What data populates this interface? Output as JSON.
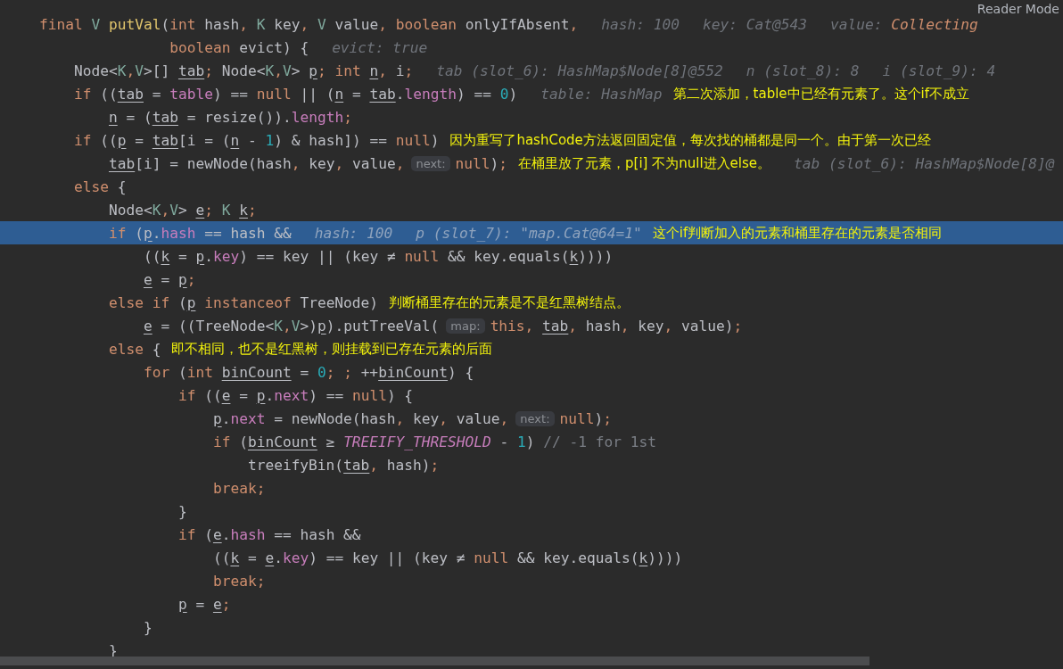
{
  "reader_mode": "Reader Mode",
  "lines": [
    {
      "highlighted": false,
      "segments": [
        {
          "kind": "code",
          "tokens": [
            {
              "kind": "kw",
              "text": "final "
            },
            {
              "kind": "generic",
              "text": "V "
            },
            {
              "kind": "method",
              "text": "putVal"
            },
            {
              "kind": "plain",
              "text": "("
            },
            {
              "kind": "kw",
              "text": "int "
            },
            {
              "kind": "plain",
              "text": "hash"
            },
            {
              "kind": "kw",
              "text": ", "
            },
            {
              "kind": "generic",
              "text": "K "
            },
            {
              "kind": "plain",
              "text": "key"
            },
            {
              "kind": "kw",
              "text": ", "
            },
            {
              "kind": "generic",
              "text": "V "
            },
            {
              "kind": "plain",
              "text": "value"
            },
            {
              "kind": "kw",
              "text": ", boolean "
            },
            {
              "kind": "plain",
              "text": "onlyIfAbsent"
            },
            {
              "kind": "kw",
              "text": ","
            }
          ]
        },
        {
          "kind": "hint",
          "tokens": [
            {
              "kind": "hint",
              "text": "hash: 100"
            }
          ]
        },
        {
          "kind": "hint",
          "tokens": [
            {
              "kind": "hint",
              "text": "key: Cat@543"
            }
          ]
        },
        {
          "kind": "hint",
          "tokens": [
            {
              "kind": "hint",
              "text": "value: "
            },
            {
              "kind": "hintvalue",
              "text": "Collecting"
            }
          ]
        }
      ]
    },
    {
      "highlighted": false,
      "segments": [
        {
          "kind": "code",
          "tokens": [
            {
              "kind": "kw",
              "text": "               boolean "
            },
            {
              "kind": "plain",
              "text": "evict) {"
            }
          ]
        },
        {
          "kind": "hint",
          "tokens": [
            {
              "kind": "hint",
              "text": "evict: true"
            }
          ]
        }
      ]
    },
    {
      "highlighted": false,
      "segments": [
        {
          "kind": "code",
          "tokens": [
            {
              "kind": "plain",
              "text": "    Node<"
            },
            {
              "kind": "generic",
              "text": "K"
            },
            {
              "kind": "kw",
              "text": ","
            },
            {
              "kind": "generic",
              "text": "V"
            },
            {
              "kind": "plain",
              "text": ">[] "
            },
            {
              "kind": "local",
              "text": "tab"
            },
            {
              "kind": "kw",
              "text": "; "
            },
            {
              "kind": "plain",
              "text": "Node<"
            },
            {
              "kind": "generic",
              "text": "K"
            },
            {
              "kind": "kw",
              "text": ","
            },
            {
              "kind": "generic",
              "text": "V"
            },
            {
              "kind": "plain",
              "text": "> "
            },
            {
              "kind": "local",
              "text": "p"
            },
            {
              "kind": "kw",
              "text": "; int "
            },
            {
              "kind": "local",
              "text": "n"
            },
            {
              "kind": "kw",
              "text": ", "
            },
            {
              "kind": "plain",
              "text": "i"
            },
            {
              "kind": "kw",
              "text": ";"
            }
          ]
        },
        {
          "kind": "hint",
          "tokens": [
            {
              "kind": "hint",
              "text": "tab (slot_6): HashMap$Node[8]@552"
            }
          ]
        },
        {
          "kind": "hint",
          "tokens": [
            {
              "kind": "hint",
              "text": "n (slot_8): 8"
            }
          ]
        },
        {
          "kind": "hint",
          "tokens": [
            {
              "kind": "hint",
              "text": "i (slot_9): 4"
            }
          ]
        }
      ]
    },
    {
      "highlighted": false,
      "segments": [
        {
          "kind": "code",
          "tokens": [
            {
              "kind": "kw",
              "text": "    if "
            },
            {
              "kind": "plain",
              "text": "(("
            },
            {
              "kind": "local",
              "text": "tab"
            },
            {
              "kind": "plain",
              "text": " = "
            },
            {
              "kind": "field",
              "text": "table"
            },
            {
              "kind": "plain",
              "text": ") == "
            },
            {
              "kind": "kw",
              "text": "null "
            },
            {
              "kind": "plain",
              "text": "|| ("
            },
            {
              "kind": "local",
              "text": "n"
            },
            {
              "kind": "plain",
              "text": " = "
            },
            {
              "kind": "local",
              "text": "tab"
            },
            {
              "kind": "plain",
              "text": "."
            },
            {
              "kind": "field",
              "text": "length"
            },
            {
              "kind": "plain",
              "text": ") == "
            },
            {
              "kind": "num",
              "text": "0"
            },
            {
              "kind": "plain",
              "text": ")"
            }
          ]
        },
        {
          "kind": "hint",
          "tokens": [
            {
              "kind": "hint",
              "text": "table: HashMap"
            }
          ]
        },
        {
          "kind": "note",
          "text": "第二次添加，table中已经有元素了。这个if不成立"
        }
      ]
    },
    {
      "highlighted": false,
      "segments": [
        {
          "kind": "code",
          "tokens": [
            {
              "kind": "local",
              "text": "        n"
            },
            {
              "kind": "plain",
              "text": " = ("
            },
            {
              "kind": "local",
              "text": "tab"
            },
            {
              "kind": "plain",
              "text": " = resize())."
            },
            {
              "kind": "field",
              "text": "length"
            },
            {
              "kind": "kw",
              "text": ";"
            }
          ]
        }
      ]
    },
    {
      "highlighted": false,
      "segments": [
        {
          "kind": "code",
          "tokens": [
            {
              "kind": "kw",
              "text": "    if "
            },
            {
              "kind": "plain",
              "text": "(("
            },
            {
              "kind": "local",
              "text": "p"
            },
            {
              "kind": "plain",
              "text": " = "
            },
            {
              "kind": "local",
              "text": "tab"
            },
            {
              "kind": "plain",
              "text": "[i = ("
            },
            {
              "kind": "local",
              "text": "n"
            },
            {
              "kind": "plain",
              "text": " - "
            },
            {
              "kind": "num",
              "text": "1"
            },
            {
              "kind": "plain",
              "text": ") & hash]) == "
            },
            {
              "kind": "kw",
              "text": "null"
            },
            {
              "kind": "plain",
              "text": ")"
            }
          ]
        },
        {
          "kind": "note",
          "text": "因为重写了hashCode方法返回固定值，每次找的桶都是同一个。由于第一次已经"
        }
      ]
    },
    {
      "highlighted": false,
      "segments": [
        {
          "kind": "code",
          "tokens": [
            {
              "kind": "local",
              "text": "        tab"
            },
            {
              "kind": "plain",
              "text": "[i] = newNode(hash"
            },
            {
              "kind": "kw",
              "text": ", "
            },
            {
              "kind": "plain",
              "text": "key"
            },
            {
              "kind": "kw",
              "text": ", "
            },
            {
              "kind": "plain",
              "text": "value"
            },
            {
              "kind": "kw",
              "text": ","
            }
          ]
        },
        {
          "kind": "param",
          "text": "next:"
        },
        {
          "kind": "code",
          "tokens": [
            {
              "kind": "kw",
              "text": "null"
            },
            {
              "kind": "plain",
              "text": ")"
            },
            {
              "kind": "kw",
              "text": ";"
            }
          ]
        },
        {
          "kind": "note",
          "text": "在桶里放了元素，p[i] 不为null进入else。"
        },
        {
          "kind": "hint",
          "tokens": [
            {
              "kind": "hint",
              "text": "tab (slot_6): HashMap$Node[8]@"
            }
          ]
        }
      ]
    },
    {
      "highlighted": false,
      "segments": [
        {
          "kind": "code",
          "tokens": [
            {
              "kind": "kw",
              "text": "    else "
            },
            {
              "kind": "plain",
              "text": "{"
            }
          ]
        }
      ]
    },
    {
      "highlighted": false,
      "segments": [
        {
          "kind": "code",
          "tokens": [
            {
              "kind": "plain",
              "text": "        Node<"
            },
            {
              "kind": "generic",
              "text": "K"
            },
            {
              "kind": "kw",
              "text": ","
            },
            {
              "kind": "generic",
              "text": "V"
            },
            {
              "kind": "plain",
              "text": "> "
            },
            {
              "kind": "local",
              "text": "e"
            },
            {
              "kind": "kw",
              "text": "; "
            },
            {
              "kind": "generic",
              "text": "K "
            },
            {
              "kind": "local",
              "text": "k"
            },
            {
              "kind": "kw",
              "text": ";"
            }
          ]
        }
      ]
    },
    {
      "highlighted": true,
      "segments": [
        {
          "kind": "code",
          "tokens": [
            {
              "kind": "kw",
              "text": "        if "
            },
            {
              "kind": "plain",
              "text": "("
            },
            {
              "kind": "local",
              "text": "p"
            },
            {
              "kind": "plain",
              "text": "."
            },
            {
              "kind": "field",
              "text": "hash"
            },
            {
              "kind": "plain",
              "text": " == hash &&"
            }
          ]
        },
        {
          "kind": "hint",
          "tokens": [
            {
              "kind": "hint",
              "text": "hash: 100"
            }
          ]
        },
        {
          "kind": "hint",
          "tokens": [
            {
              "kind": "hint",
              "text": "p (slot_7): \"map.Cat@64=1\""
            }
          ]
        },
        {
          "kind": "note",
          "text": "这个if判断加入的元素和桶里存在的元素是否相同"
        }
      ]
    },
    {
      "highlighted": false,
      "segments": [
        {
          "kind": "code",
          "tokens": [
            {
              "kind": "plain",
              "text": "            (("
            },
            {
              "kind": "local",
              "text": "k"
            },
            {
              "kind": "plain",
              "text": " = "
            },
            {
              "kind": "local",
              "text": "p"
            },
            {
              "kind": "plain",
              "text": "."
            },
            {
              "kind": "field",
              "text": "key"
            },
            {
              "kind": "plain",
              "text": ") == key || (key ≠ "
            },
            {
              "kind": "kw",
              "text": "null "
            },
            {
              "kind": "plain",
              "text": "&& key.equals("
            },
            {
              "kind": "local",
              "text": "k"
            },
            {
              "kind": "plain",
              "text": "))))"
            }
          ]
        }
      ]
    },
    {
      "highlighted": false,
      "segments": [
        {
          "kind": "code",
          "tokens": [
            {
              "kind": "local",
              "text": "            e"
            },
            {
              "kind": "plain",
              "text": " = "
            },
            {
              "kind": "local",
              "text": "p"
            },
            {
              "kind": "kw",
              "text": ";"
            }
          ]
        }
      ]
    },
    {
      "highlighted": false,
      "segments": [
        {
          "kind": "code",
          "tokens": [
            {
              "kind": "kw",
              "text": "        else if "
            },
            {
              "kind": "plain",
              "text": "("
            },
            {
              "kind": "local",
              "text": "p"
            },
            {
              "kind": "kw",
              "text": " instanceof "
            },
            {
              "kind": "plain",
              "text": "TreeNode)"
            }
          ]
        },
        {
          "kind": "note",
          "text": "判断桶里存在的元素是不是红黑树结点。"
        }
      ]
    },
    {
      "highlighted": false,
      "segments": [
        {
          "kind": "code",
          "tokens": [
            {
              "kind": "local",
              "text": "            e"
            },
            {
              "kind": "plain",
              "text": " = ((TreeNode<"
            },
            {
              "kind": "generic",
              "text": "K"
            },
            {
              "kind": "kw",
              "text": ","
            },
            {
              "kind": "generic",
              "text": "V"
            },
            {
              "kind": "plain",
              "text": ">)"
            },
            {
              "kind": "local",
              "text": "p"
            },
            {
              "kind": "plain",
              "text": ").putTreeVal("
            }
          ]
        },
        {
          "kind": "param",
          "text": "map:"
        },
        {
          "kind": "code",
          "tokens": [
            {
              "kind": "kw",
              "text": "this, "
            },
            {
              "kind": "local",
              "text": "tab"
            },
            {
              "kind": "kw",
              "text": ", "
            },
            {
              "kind": "plain",
              "text": "hash"
            },
            {
              "kind": "kw",
              "text": ", "
            },
            {
              "kind": "plain",
              "text": "key"
            },
            {
              "kind": "kw",
              "text": ", "
            },
            {
              "kind": "plain",
              "text": "value)"
            },
            {
              "kind": "kw",
              "text": ";"
            }
          ]
        }
      ]
    },
    {
      "highlighted": false,
      "segments": [
        {
          "kind": "code",
          "tokens": [
            {
              "kind": "kw",
              "text": "        else "
            },
            {
              "kind": "plain",
              "text": "{"
            }
          ]
        },
        {
          "kind": "note",
          "text": "即不相同，也不是红黑树，则挂载到已存在元素的后面"
        }
      ]
    },
    {
      "highlighted": false,
      "segments": [
        {
          "kind": "code",
          "tokens": [
            {
              "kind": "kw",
              "text": "            for "
            },
            {
              "kind": "plain",
              "text": "("
            },
            {
              "kind": "kw",
              "text": "int "
            },
            {
              "kind": "local",
              "text": "binCount"
            },
            {
              "kind": "plain",
              "text": " = "
            },
            {
              "kind": "num",
              "text": "0"
            },
            {
              "kind": "kw",
              "text": "; ; "
            },
            {
              "kind": "plain",
              "text": "++"
            },
            {
              "kind": "local",
              "text": "binCount"
            },
            {
              "kind": "plain",
              "text": ") {"
            }
          ]
        }
      ]
    },
    {
      "highlighted": false,
      "segments": [
        {
          "kind": "code",
          "tokens": [
            {
              "kind": "kw",
              "text": "                if "
            },
            {
              "kind": "plain",
              "text": "(("
            },
            {
              "kind": "local",
              "text": "e"
            },
            {
              "kind": "plain",
              "text": " = "
            },
            {
              "kind": "local",
              "text": "p"
            },
            {
              "kind": "plain",
              "text": "."
            },
            {
              "kind": "field",
              "text": "next"
            },
            {
              "kind": "plain",
              "text": ") == "
            },
            {
              "kind": "kw",
              "text": "null"
            },
            {
              "kind": "plain",
              "text": ") {"
            }
          ]
        }
      ]
    },
    {
      "highlighted": false,
      "segments": [
        {
          "kind": "code",
          "tokens": [
            {
              "kind": "local",
              "text": "                    p"
            },
            {
              "kind": "plain",
              "text": "."
            },
            {
              "kind": "field",
              "text": "next"
            },
            {
              "kind": "plain",
              "text": " = newNode(hash"
            },
            {
              "kind": "kw",
              "text": ", "
            },
            {
              "kind": "plain",
              "text": "key"
            },
            {
              "kind": "kw",
              "text": ", "
            },
            {
              "kind": "plain",
              "text": "value"
            },
            {
              "kind": "kw",
              "text": ","
            }
          ]
        },
        {
          "kind": "param",
          "text": "next:"
        },
        {
          "kind": "code",
          "tokens": [
            {
              "kind": "kw",
              "text": "null"
            },
            {
              "kind": "plain",
              "text": ")"
            },
            {
              "kind": "kw",
              "text": ";"
            }
          ]
        }
      ]
    },
    {
      "highlighted": false,
      "segments": [
        {
          "kind": "code",
          "tokens": [
            {
              "kind": "kw",
              "text": "                    if "
            },
            {
              "kind": "plain",
              "text": "("
            },
            {
              "kind": "local",
              "text": "binCount"
            },
            {
              "kind": "plain",
              "text": " ≥ "
            },
            {
              "kind": "const",
              "text": "TREEIFY_THRESHOLD"
            },
            {
              "kind": "plain",
              "text": " - "
            },
            {
              "kind": "num",
              "text": "1"
            },
            {
              "kind": "plain",
              "text": ") "
            },
            {
              "kind": "comment",
              "text": "// -1 for 1st"
            }
          ]
        }
      ]
    },
    {
      "highlighted": false,
      "segments": [
        {
          "kind": "code",
          "tokens": [
            {
              "kind": "plain",
              "text": "                        treeifyBin("
            },
            {
              "kind": "local",
              "text": "tab"
            },
            {
              "kind": "kw",
              "text": ", "
            },
            {
              "kind": "plain",
              "text": "hash)"
            },
            {
              "kind": "kw",
              "text": ";"
            }
          ]
        }
      ]
    },
    {
      "highlighted": false,
      "segments": [
        {
          "kind": "code",
          "tokens": [
            {
              "kind": "kw",
              "text": "                    break;"
            }
          ]
        }
      ]
    },
    {
      "highlighted": false,
      "segments": [
        {
          "kind": "code",
          "tokens": [
            {
              "kind": "plain",
              "text": "                }"
            }
          ]
        }
      ]
    },
    {
      "highlighted": false,
      "segments": [
        {
          "kind": "code",
          "tokens": [
            {
              "kind": "kw",
              "text": "                if "
            },
            {
              "kind": "plain",
              "text": "("
            },
            {
              "kind": "local",
              "text": "e"
            },
            {
              "kind": "plain",
              "text": "."
            },
            {
              "kind": "field",
              "text": "hash"
            },
            {
              "kind": "plain",
              "text": " == hash &&"
            }
          ]
        }
      ]
    },
    {
      "highlighted": false,
      "segments": [
        {
          "kind": "code",
          "tokens": [
            {
              "kind": "plain",
              "text": "                    (("
            },
            {
              "kind": "local",
              "text": "k"
            },
            {
              "kind": "plain",
              "text": " = "
            },
            {
              "kind": "local",
              "text": "e"
            },
            {
              "kind": "plain",
              "text": "."
            },
            {
              "kind": "field",
              "text": "key"
            },
            {
              "kind": "plain",
              "text": ") == key || (key ≠ "
            },
            {
              "kind": "kw",
              "text": "null "
            },
            {
              "kind": "plain",
              "text": "&& key.equals("
            },
            {
              "kind": "local",
              "text": "k"
            },
            {
              "kind": "plain",
              "text": "))))"
            }
          ]
        }
      ]
    },
    {
      "highlighted": false,
      "segments": [
        {
          "kind": "code",
          "tokens": [
            {
              "kind": "kw",
              "text": "                    break;"
            }
          ]
        }
      ]
    },
    {
      "highlighted": false,
      "segments": [
        {
          "kind": "code",
          "tokens": [
            {
              "kind": "local",
              "text": "                p"
            },
            {
              "kind": "plain",
              "text": " = "
            },
            {
              "kind": "local",
              "text": "e"
            },
            {
              "kind": "kw",
              "text": ";"
            }
          ]
        }
      ]
    },
    {
      "highlighted": false,
      "segments": [
        {
          "kind": "code",
          "tokens": [
            {
              "kind": "plain",
              "text": "            }"
            }
          ]
        }
      ]
    },
    {
      "highlighted": false,
      "segments": [
        {
          "kind": "code",
          "tokens": [
            {
              "kind": "plain",
              "text": "        }"
            }
          ]
        }
      ]
    }
  ]
}
